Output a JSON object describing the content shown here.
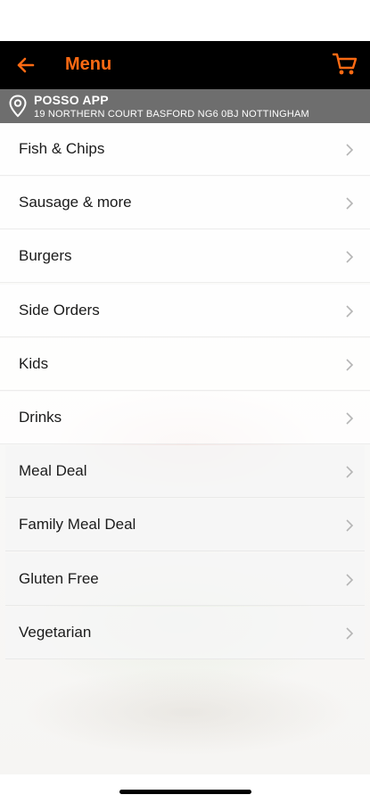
{
  "header": {
    "title": "Menu",
    "back_icon": "arrow-left-icon",
    "cart_icon": "cart-icon",
    "accent_color": "#ff6a13",
    "background_color": "#000000"
  },
  "store": {
    "name": "POSSO APP",
    "address": "19 NORTHERN COURT BASFORD NG6 0BJ NOTTINGHAM",
    "icon": "location-pin-icon"
  },
  "menu": {
    "items": [
      {
        "label": "Fish & Chips"
      },
      {
        "label": "Sausage & more"
      },
      {
        "label": "Burgers"
      },
      {
        "label": "Side Orders"
      },
      {
        "label": "Kids"
      },
      {
        "label": "Drinks"
      },
      {
        "label": "Meal Deal"
      },
      {
        "label": "Family Meal Deal"
      },
      {
        "label": "Gluten Free"
      },
      {
        "label": "Vegetarian"
      }
    ],
    "chevron_icon": "chevron-right-icon"
  }
}
